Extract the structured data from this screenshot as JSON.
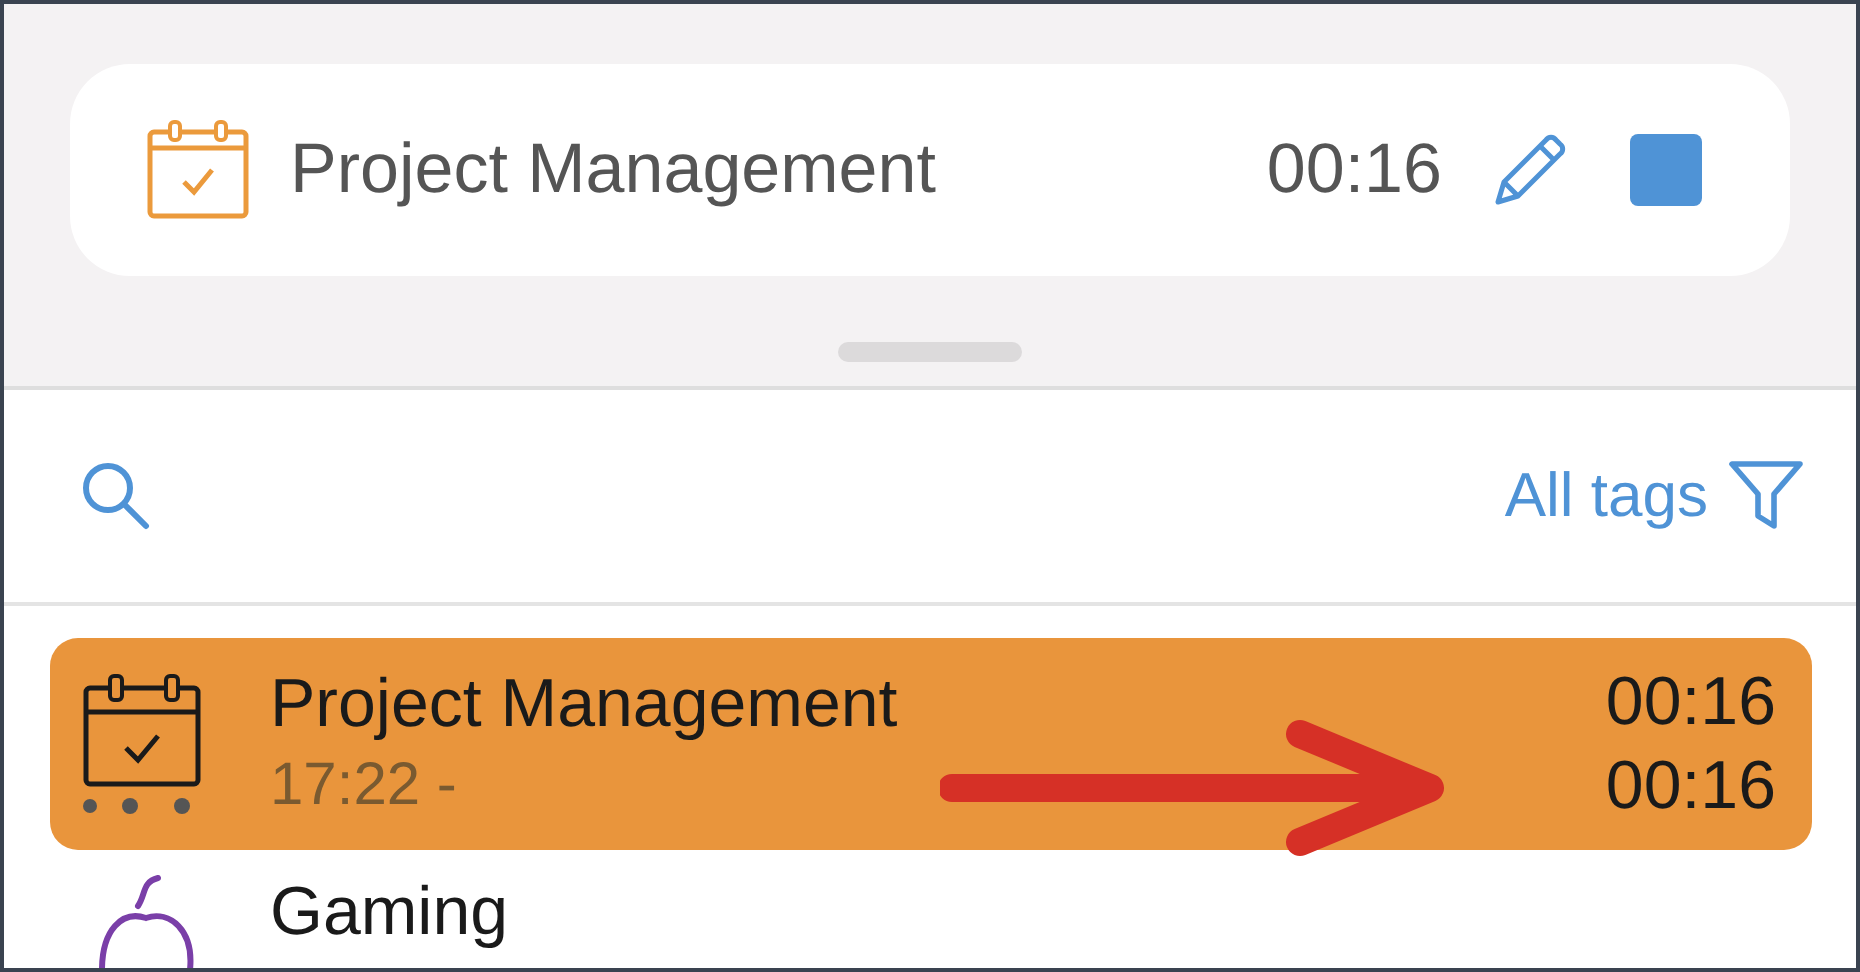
{
  "current_timer": {
    "title": "Project Management",
    "elapsed": "00:16",
    "running": true
  },
  "filter": {
    "label": "All tags"
  },
  "entries": [
    {
      "kind": "running",
      "title": "Project Management",
      "start": "17:22 -",
      "duration": "00:16",
      "total": "00:16",
      "selected": true
    },
    {
      "kind": "gaming",
      "title": "Gaming",
      "selected": false
    }
  ],
  "annotation": {
    "kind": "arrow"
  }
}
